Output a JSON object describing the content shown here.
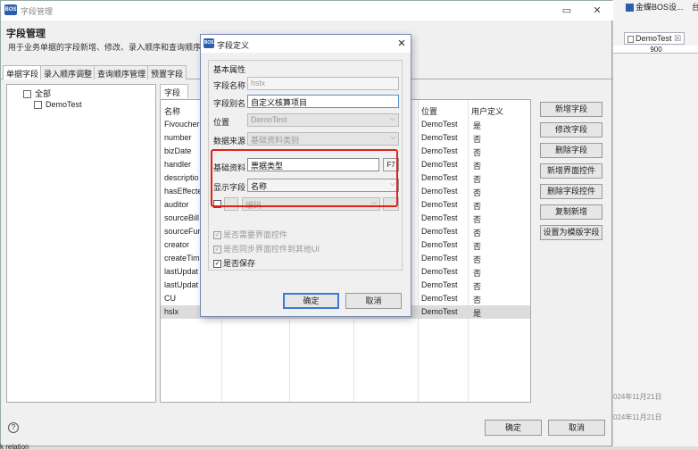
{
  "main": {
    "window_title": "字段管理",
    "heading": "字段管理",
    "description": "用于业务单据的字段新增、修改、录入顺序和查询顺序的",
    "tabs": [
      "单据字段",
      "录入顺序调整",
      "查询顺序管理",
      "预置字段"
    ],
    "tree": {
      "root": "全部",
      "child": "DemoTest"
    },
    "fields_tab": "字段",
    "columns": [
      "名称",
      "位置",
      "用户定义"
    ],
    "rows": [
      {
        "name": "Fivoucher",
        "loc": "DemoTest",
        "user": "是"
      },
      {
        "name": "number",
        "loc": "DemoTest",
        "user": "否"
      },
      {
        "name": "bizDate",
        "loc": "DemoTest",
        "user": "否"
      },
      {
        "name": "handler",
        "loc": "DemoTest",
        "user": "否"
      },
      {
        "name": "descriptio",
        "loc": "DemoTest",
        "user": "否"
      },
      {
        "name": "hasEffecte",
        "loc": "DemoTest",
        "user": "否"
      },
      {
        "name": "auditor",
        "loc": "DemoTest",
        "user": "否"
      },
      {
        "name": "sourceBill",
        "loc": "DemoTest",
        "user": "否"
      },
      {
        "name": "sourceFur",
        "loc": "DemoTest",
        "user": "否"
      },
      {
        "name": "creator",
        "loc": "DemoTest",
        "user": "否"
      },
      {
        "name": "createTim",
        "loc": "DemoTest",
        "user": "否"
      },
      {
        "name": "lastUpdat",
        "loc": "DemoTest",
        "user": "否"
      },
      {
        "name": "lastUpdat",
        "loc": "DemoTest",
        "user": "否"
      },
      {
        "name": "CU",
        "loc": "DemoTest",
        "user": "否"
      },
      {
        "name": "hslx",
        "loc": "DemoTest",
        "user": "是"
      }
    ],
    "right_buttons": [
      "新增字段",
      "修改字段",
      "删除字段",
      "新增界面控件",
      "删除字段控件",
      "复制新增",
      "设置为模版字段"
    ],
    "ok_label": "确定",
    "cancel_label": "取消",
    "help_glyph": "?"
  },
  "ide": {
    "top_tab": "金蝶BOS设...",
    "top_tab_extra": "台",
    "editor_tab": "DemoTest",
    "editor_tab_close": "☒",
    "ruler_value": "900",
    "date_1": "024年11月21日",
    "date_2": "024年11月21日",
    "bottom_text": "k relation"
  },
  "dialog": {
    "title": "字段定义",
    "group_label": "基本属性",
    "field_name_label": "字段名称",
    "field_name_value": "hslx",
    "field_alias_label": "字段别名",
    "field_alias_value": "自定义核算项目",
    "location_label": "位置",
    "location_value": "DemoTest",
    "data_source_label": "数据来源",
    "data_source_value": "基础资料类别",
    "base_data_label": "基础资料",
    "base_data_value": "票据类型",
    "base_data_button": "F7",
    "display_field_label": "显示字段",
    "display_field_value": "名称",
    "code_value": "编码",
    "need_ui_label": "是否需要界面控件",
    "sync_ui_label": "是否同步界面控件到其他UI",
    "save_label": "是否保存",
    "ok_label": "确定",
    "cancel_label": "取消",
    "check_glyph": "✓"
  },
  "colors": {
    "accent": "#3b78d8",
    "highlight": "#e0231a",
    "brand": "#2a5fb0"
  }
}
